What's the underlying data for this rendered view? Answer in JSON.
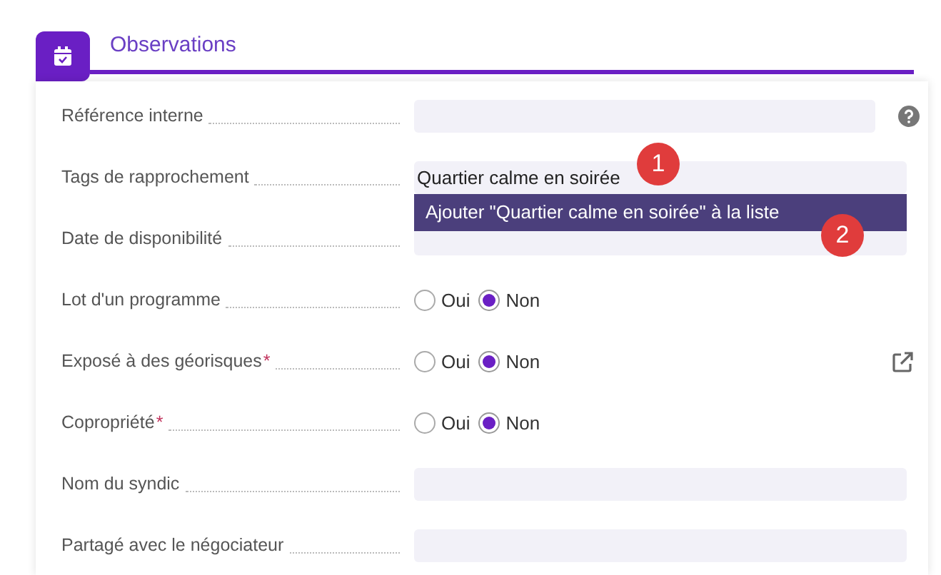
{
  "section": {
    "title": "Observations"
  },
  "rows": [
    {
      "kind": "text",
      "label": "Référence interne",
      "help": true
    },
    {
      "kind": "tags",
      "label": "Tags de rapprochement",
      "value": "Quartier calme en soirée",
      "suggestion": "Ajouter \"Quartier calme en soirée\" à la liste"
    },
    {
      "kind": "text",
      "label": "Date de disponibilité"
    },
    {
      "kind": "radio",
      "label": "Lot d'un programme",
      "options": [
        {
          "label": "Oui",
          "selected": false
        },
        {
          "label": "Non",
          "selected": true
        }
      ]
    },
    {
      "kind": "radio",
      "label": "Exposé à des géorisques",
      "required_mark": "*",
      "external_link": true,
      "options": [
        {
          "label": "Oui",
          "selected": false
        },
        {
          "label": "Non",
          "selected": true
        }
      ]
    },
    {
      "kind": "radio",
      "label": "Copropriété",
      "required_mark": "*",
      "options": [
        {
          "label": "Oui",
          "selected": false
        },
        {
          "label": "Non",
          "selected": true
        }
      ]
    },
    {
      "kind": "text",
      "label": "Nom du syndic"
    },
    {
      "kind": "text",
      "label": "Partagé avec le négociateur"
    }
  ],
  "callouts": [
    "1",
    "2"
  ]
}
